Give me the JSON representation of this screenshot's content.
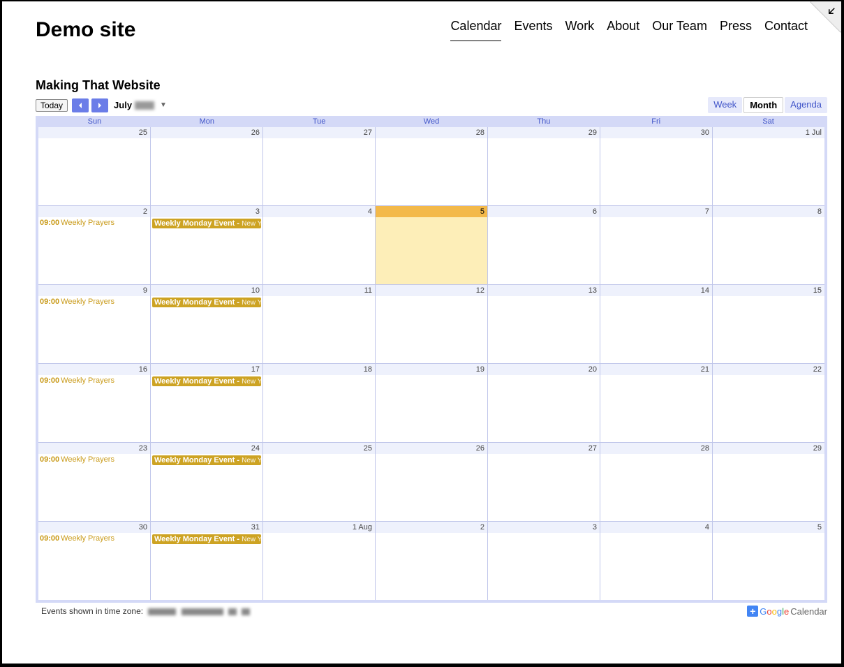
{
  "site": {
    "title": "Demo site"
  },
  "nav": {
    "items": [
      "Calendar",
      "Events",
      "Work",
      "About",
      "Our Team",
      "Press",
      "Contact"
    ],
    "active": 0
  },
  "calendar": {
    "title": "Making That Website",
    "todayLabel": "Today",
    "monthLabel": "July",
    "views": {
      "week": "Week",
      "month": "Month",
      "agenda": "Agenda",
      "active": "Month"
    },
    "dayHeaders": [
      "Sun",
      "Mon",
      "Tue",
      "Wed",
      "Thu",
      "Fri",
      "Sat"
    ],
    "weeks": [
      [
        {
          "label": "25"
        },
        {
          "label": "26"
        },
        {
          "label": "27"
        },
        {
          "label": "28"
        },
        {
          "label": "29"
        },
        {
          "label": "30"
        },
        {
          "label": "1 Jul"
        }
      ],
      [
        {
          "label": "2",
          "events": [
            {
              "type": "timed",
              "time": "09:00",
              "text": "Weekly Prayers"
            }
          ]
        },
        {
          "label": "3",
          "events": [
            {
              "type": "allday",
              "text": "Weekly Monday Event - ",
              "sub": "New Y"
            }
          ]
        },
        {
          "label": "4"
        },
        {
          "label": "5",
          "today": true
        },
        {
          "label": "6"
        },
        {
          "label": "7"
        },
        {
          "label": "8"
        }
      ],
      [
        {
          "label": "9",
          "events": [
            {
              "type": "timed",
              "time": "09:00",
              "text": "Weekly Prayers"
            }
          ]
        },
        {
          "label": "10",
          "events": [
            {
              "type": "allday",
              "text": "Weekly Monday Event - ",
              "sub": "New Y"
            }
          ]
        },
        {
          "label": "11"
        },
        {
          "label": "12"
        },
        {
          "label": "13"
        },
        {
          "label": "14"
        },
        {
          "label": "15"
        }
      ],
      [
        {
          "label": "16",
          "events": [
            {
              "type": "timed",
              "time": "09:00",
              "text": "Weekly Prayers"
            }
          ]
        },
        {
          "label": "17",
          "events": [
            {
              "type": "allday",
              "text": "Weekly Monday Event - ",
              "sub": "New Y"
            }
          ]
        },
        {
          "label": "18"
        },
        {
          "label": "19"
        },
        {
          "label": "20"
        },
        {
          "label": "21"
        },
        {
          "label": "22"
        }
      ],
      [
        {
          "label": "23",
          "events": [
            {
              "type": "timed",
              "time": "09:00",
              "text": "Weekly Prayers"
            }
          ]
        },
        {
          "label": "24",
          "events": [
            {
              "type": "allday",
              "text": "Weekly Monday Event - ",
              "sub": "New Y"
            }
          ]
        },
        {
          "label": "25"
        },
        {
          "label": "26"
        },
        {
          "label": "27"
        },
        {
          "label": "28"
        },
        {
          "label": "29"
        }
      ],
      [
        {
          "label": "30",
          "events": [
            {
              "type": "timed",
              "time": "09:00",
              "text": "Weekly Prayers"
            }
          ]
        },
        {
          "label": "31",
          "events": [
            {
              "type": "allday",
              "text": "Weekly Monday Event - ",
              "sub": "New Y"
            }
          ]
        },
        {
          "label": "1 Aug"
        },
        {
          "label": "2"
        },
        {
          "label": "3"
        },
        {
          "label": "4"
        },
        {
          "label": "5"
        }
      ]
    ],
    "footer": {
      "tzLabel": "Events shown in time zone:",
      "brand": "Calendar"
    }
  }
}
